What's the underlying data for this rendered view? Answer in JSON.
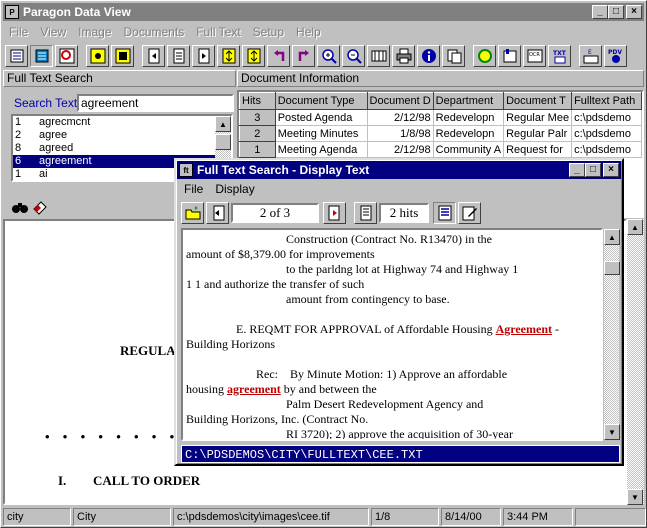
{
  "app": {
    "title": "Paragon Data View",
    "menu": [
      "File",
      "View",
      "Image",
      "Documents",
      "Full Text",
      "Setup",
      "Help"
    ]
  },
  "fulltext_panel": {
    "header": "Full Text Search",
    "search_label": "Search Text",
    "search_value": "agreement",
    "words": [
      {
        "count": "1",
        "word": "agrecmcnt"
      },
      {
        "count": "2",
        "word": "agree"
      },
      {
        "count": "8",
        "word": "agreed"
      },
      {
        "count": "6",
        "word": "agreement"
      },
      {
        "count": "1",
        "word": "ai"
      }
    ]
  },
  "doc_info": {
    "header": "Document Information",
    "columns": [
      "Hits",
      "Document Type",
      "Document D",
      "Department",
      "Document T",
      "Fulltext Path"
    ],
    "rows": [
      [
        "3",
        "Posted Agenda",
        "2/12/98",
        "Redevelopn",
        "Regular Mee",
        "c:\\pdsdemo"
      ],
      [
        "2",
        "Meeting Minutes",
        "1/8/98",
        "Redevelopn",
        "Regular Palr",
        "c:\\pdsdemo"
      ],
      [
        "1",
        "Meeting Agenda",
        "2/12/98",
        "Community A",
        "Request for",
        "c:\\pdsdemo"
      ]
    ]
  },
  "document_image": {
    "heading": "REGULAR",
    "dots": "• • • • • • • •",
    "section_num": "I.",
    "section_title": "CALL TO ORDER"
  },
  "dialog": {
    "title": "Full Text Search - Display Text",
    "menu": [
      "File",
      "Display"
    ],
    "page_indicator": "2 of 3",
    "hits_indicator": "2 hits",
    "text_lines": [
      {
        "indent": 100,
        "text": "Construction (Contract No. R13470) in the"
      },
      {
        "indent": 0,
        "text": "amount of $8,379.00 for improvements"
      },
      {
        "indent": 100,
        "text": "to the parldng lot at Highway 74 and Highway 1"
      },
      {
        "indent": 0,
        "text": "1 1 and authorize the transfer of such"
      },
      {
        "indent": 100,
        "text": "amount from contingency to base."
      },
      {
        "indent": 0,
        "text": ""
      },
      {
        "indent": 50,
        "pre": "E. REQMT FOR APPROVAL of Affordable Housing ",
        "hit": "Agreement",
        "post": " -"
      },
      {
        "indent": 0,
        "text": "Building Horizons"
      },
      {
        "indent": 0,
        "text": ""
      },
      {
        "indent": 70,
        "text": "Rec:    By Minute Motion: 1) Approve an affordable"
      },
      {
        "indent": 0,
        "pre": "housing ",
        "hit": "agreement",
        "post": " by and between the"
      },
      {
        "indent": 100,
        "text": "Palm Desert Redevelopment Agency and"
      },
      {
        "indent": 0,
        "text": "Building Horizons, Inc. (Contract No."
      },
      {
        "indent": 100,
        "text": "RI 3720); 2) approve the acquisition of 30-year"
      }
    ],
    "path": "C:\\PDSDEMOS\\CITY\\FULLTEXT\\CEE.TXT"
  },
  "status": [
    "city",
    "City",
    "c:\\pdsdemos\\city\\images\\cee.tif",
    "1/8",
    "8/14/00",
    "3:44 PM"
  ]
}
